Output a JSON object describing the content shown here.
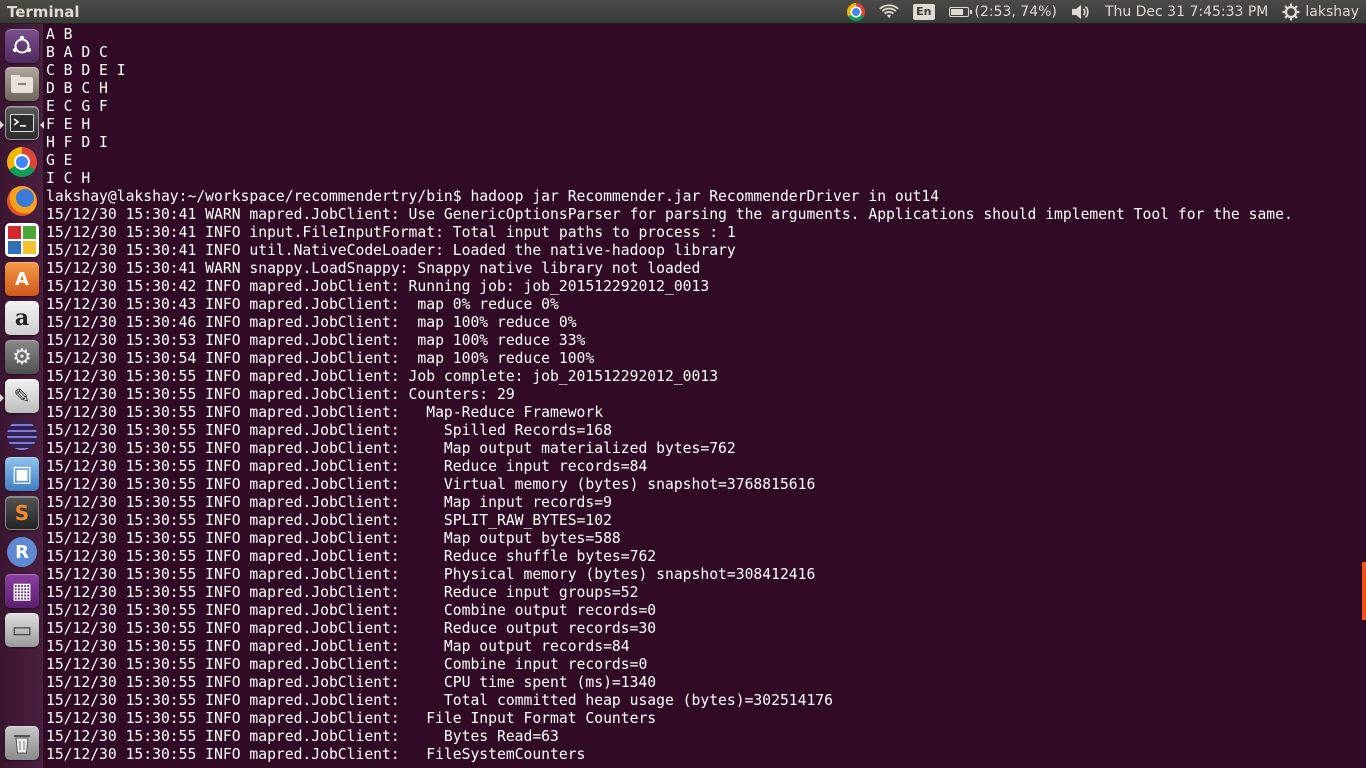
{
  "panel": {
    "title": "Terminal",
    "keyboard_layout": "En",
    "battery_text": "(2:53, 74%)",
    "clock": "Thu Dec 31  7:45:33 PM",
    "user": "lakshay",
    "indicators": [
      "chrome-icon",
      "wifi-icon",
      "keyboard-icon",
      "battery-icon",
      "volume-icon",
      "session-gear-icon"
    ]
  },
  "launcher": {
    "items": [
      {
        "name": "dash-icon",
        "glyph": "◉"
      },
      {
        "name": "files-icon",
        "glyph": "▤"
      },
      {
        "name": "terminal-icon",
        "glyph": ">_"
      },
      {
        "name": "chrome-icon",
        "glyph": ""
      },
      {
        "name": "firefox-icon",
        "glyph": ""
      },
      {
        "name": "libreoffice-icon",
        "glyph": ""
      },
      {
        "name": "software-center-icon",
        "glyph": "A"
      },
      {
        "name": "amazon-icon",
        "glyph": "a"
      },
      {
        "name": "system-settings-icon",
        "glyph": "⚙"
      },
      {
        "name": "text-editor-icon",
        "glyph": "✎"
      },
      {
        "name": "eclipse-icon",
        "glyph": "◐"
      },
      {
        "name": "virtualbox-icon",
        "glyph": "▣"
      },
      {
        "name": "sublime-text-icon",
        "glyph": "S"
      },
      {
        "name": "rstudio-icon",
        "glyph": "R"
      },
      {
        "name": "workspace-switcher-icon",
        "glyph": "▦"
      },
      {
        "name": "drive-icon",
        "glyph": "▭"
      },
      {
        "name": "trash-icon",
        "glyph": "🗑"
      }
    ]
  },
  "terminal": {
    "lines": [
      "A B",
      "B A D C",
      "C B D E I",
      "D B C H",
      "E C G F",
      "F E H",
      "H F D I",
      "G E",
      "I C H",
      "lakshay@lakshay:~/workspace/recommendertry/bin$ hadoop jar Recommender.jar RecommenderDriver in out14",
      "15/12/30 15:30:41 WARN mapred.JobClient: Use GenericOptionsParser for parsing the arguments. Applications should implement Tool for the same.",
      "15/12/30 15:30:41 INFO input.FileInputFormat: Total input paths to process : 1",
      "15/12/30 15:30:41 INFO util.NativeCodeLoader: Loaded the native-hadoop library",
      "15/12/30 15:30:41 WARN snappy.LoadSnappy: Snappy native library not loaded",
      "15/12/30 15:30:42 INFO mapred.JobClient: Running job: job_201512292012_0013",
      "15/12/30 15:30:43 INFO mapred.JobClient:  map 0% reduce 0%",
      "15/12/30 15:30:46 INFO mapred.JobClient:  map 100% reduce 0%",
      "15/12/30 15:30:53 INFO mapred.JobClient:  map 100% reduce 33%",
      "15/12/30 15:30:54 INFO mapred.JobClient:  map 100% reduce 100%",
      "15/12/30 15:30:55 INFO mapred.JobClient: Job complete: job_201512292012_0013",
      "15/12/30 15:30:55 INFO mapred.JobClient: Counters: 29",
      "15/12/30 15:30:55 INFO mapred.JobClient:   Map-Reduce Framework",
      "15/12/30 15:30:55 INFO mapred.JobClient:     Spilled Records=168",
      "15/12/30 15:30:55 INFO mapred.JobClient:     Map output materialized bytes=762",
      "15/12/30 15:30:55 INFO mapred.JobClient:     Reduce input records=84",
      "15/12/30 15:30:55 INFO mapred.JobClient:     Virtual memory (bytes) snapshot=3768815616",
      "15/12/30 15:30:55 INFO mapred.JobClient:     Map input records=9",
      "15/12/30 15:30:55 INFO mapred.JobClient:     SPLIT_RAW_BYTES=102",
      "15/12/30 15:30:55 INFO mapred.JobClient:     Map output bytes=588",
      "15/12/30 15:30:55 INFO mapred.JobClient:     Reduce shuffle bytes=762",
      "15/12/30 15:30:55 INFO mapred.JobClient:     Physical memory (bytes) snapshot=308412416",
      "15/12/30 15:30:55 INFO mapred.JobClient:     Reduce input groups=52",
      "15/12/30 15:30:55 INFO mapred.JobClient:     Combine output records=0",
      "15/12/30 15:30:55 INFO mapred.JobClient:     Reduce output records=30",
      "15/12/30 15:30:55 INFO mapred.JobClient:     Map output records=84",
      "15/12/30 15:30:55 INFO mapred.JobClient:     Combine input records=0",
      "15/12/30 15:30:55 INFO mapred.JobClient:     CPU time spent (ms)=1340",
      "15/12/30 15:30:55 INFO mapred.JobClient:     Total committed heap usage (bytes)=302514176",
      "15/12/30 15:30:55 INFO mapred.JobClient:   File Input Format Counters",
      "15/12/30 15:30:55 INFO mapred.JobClient:     Bytes Read=63",
      "15/12/30 15:30:55 INFO mapred.JobClient:   FileSystemCounters"
    ]
  }
}
